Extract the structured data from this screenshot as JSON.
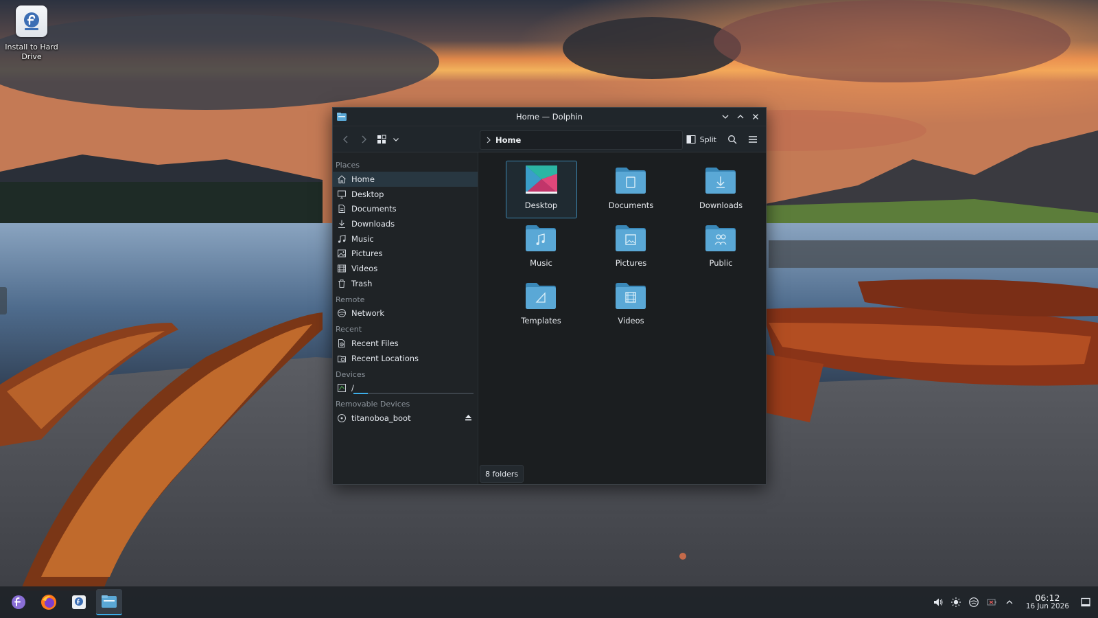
{
  "desktop": {
    "icon_label": "Install to Hard Drive"
  },
  "window": {
    "title": "Home — Dolphin",
    "location_crumb": "Home",
    "split_label": "Split",
    "status": "8 folders"
  },
  "sidebar": {
    "places_title": "Places",
    "places": [
      {
        "label": "Home",
        "icon": "home-icon"
      },
      {
        "label": "Desktop",
        "icon": "desktop-icon"
      },
      {
        "label": "Documents",
        "icon": "documents-icon"
      },
      {
        "label": "Downloads",
        "icon": "downloads-icon"
      },
      {
        "label": "Music",
        "icon": "music-icon"
      },
      {
        "label": "Pictures",
        "icon": "pictures-icon"
      },
      {
        "label": "Videos",
        "icon": "videos-icon"
      },
      {
        "label": "Trash",
        "icon": "trash-icon"
      }
    ],
    "remote_title": "Remote",
    "remote": [
      {
        "label": "Network",
        "icon": "network-icon"
      }
    ],
    "recent_title": "Recent",
    "recent": [
      {
        "label": "Recent Files",
        "icon": "recent-files-icon"
      },
      {
        "label": "Recent Locations",
        "icon": "recent-locations-icon"
      }
    ],
    "devices_title": "Devices",
    "devices": [
      {
        "label": "/",
        "icon": "drive-icon",
        "usage_fraction": 0.12
      }
    ],
    "removable_title": "Removable Devices",
    "removable": [
      {
        "label": "titanoboa_boot",
        "icon": "removable-drive-icon"
      }
    ]
  },
  "folders": [
    {
      "label": "Desktop",
      "icon": "desktop-folder-icon",
      "selected": true
    },
    {
      "label": "Documents",
      "icon": "documents-folder-icon"
    },
    {
      "label": "Downloads",
      "icon": "downloads-folder-icon"
    },
    {
      "label": "Music",
      "icon": "music-folder-icon"
    },
    {
      "label": "Pictures",
      "icon": "pictures-folder-icon"
    },
    {
      "label": "Public",
      "icon": "public-folder-icon"
    },
    {
      "label": "Templates",
      "icon": "templates-folder-icon"
    },
    {
      "label": "Videos",
      "icon": "videos-folder-icon"
    }
  ],
  "taskbar": {
    "apps": [
      "launcher-icon",
      "firefox-icon",
      "installer-icon",
      "dolphin-icon"
    ],
    "time": "06:12",
    "date": "16 Jun 2026"
  },
  "colors": {
    "accent": "#3daee9",
    "folder": "#5aa8d6"
  }
}
